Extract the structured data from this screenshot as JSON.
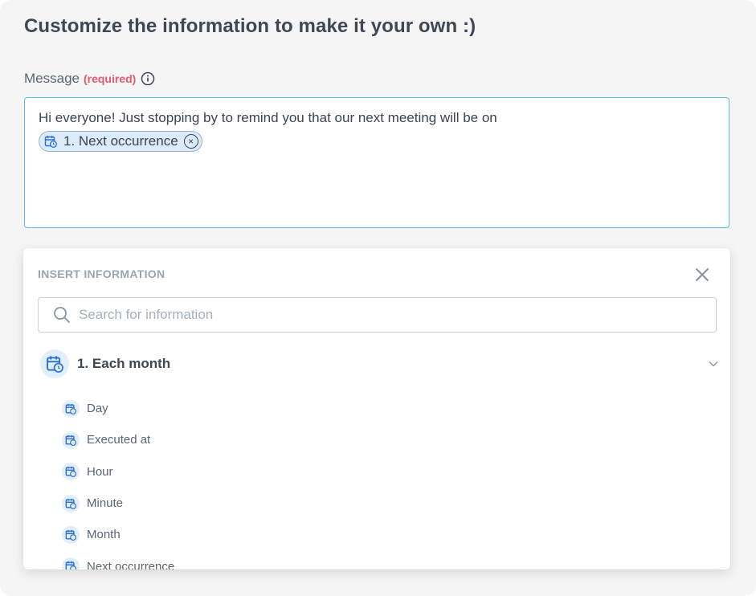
{
  "title": "Customize the information to make it your own :)",
  "message_field": {
    "label": "Message",
    "required": "(required)",
    "text": "Hi everyone! Just stopping by to remind you that our next meeting will be on",
    "chip_label": "1. Next occurrence",
    "chip_remove_icon": "×"
  },
  "insert_panel": {
    "header": "INSERT INFORMATION",
    "search_placeholder": "Search for information",
    "group": {
      "label": "1. Each month",
      "expanded": true
    },
    "items": [
      {
        "label": "Day"
      },
      {
        "label": "Executed at"
      },
      {
        "label": "Hour"
      },
      {
        "label": "Minute"
      },
      {
        "label": "Month"
      },
      {
        "label": "Next occurrence"
      }
    ]
  },
  "colors": {
    "accent_border": "#5fb8e3",
    "icon_blue": "#2b6fd1",
    "required_red": "#e45a6e",
    "chip_bg": "#dcebf9"
  }
}
